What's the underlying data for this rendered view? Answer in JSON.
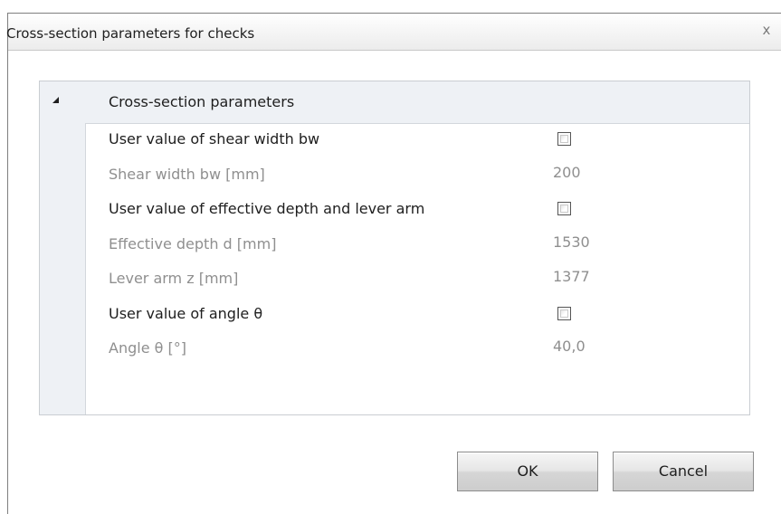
{
  "dialog": {
    "title": "Cross-section parameters for checks",
    "close_icon": "close-icon",
    "close_glyph": "x"
  },
  "grid": {
    "section_title": "Cross-section parameters",
    "section_expanded": true,
    "rows": [
      {
        "label": "User value of shear width bw",
        "type": "checkbox",
        "checked": false,
        "enabled": true
      },
      {
        "label": "Shear width bw [mm]",
        "type": "value",
        "value": "200",
        "enabled": false
      },
      {
        "label": "User value of effective depth and lever arm",
        "type": "checkbox",
        "checked": false,
        "enabled": true
      },
      {
        "label": "Effective depth d [mm]",
        "type": "value",
        "value": "1530",
        "enabled": false
      },
      {
        "label": "Lever arm z [mm]",
        "type": "value",
        "value": "1377",
        "enabled": false
      },
      {
        "label": "User value of angle θ",
        "type": "checkbox",
        "checked": false,
        "enabled": true
      },
      {
        "label": "Angle θ [°]",
        "type": "value",
        "value": "40,0",
        "enabled": false
      }
    ]
  },
  "buttons": {
    "ok_label": "OK",
    "cancel_label": "Cancel"
  },
  "colors": {
    "header_bg": "#eef1f5",
    "disabled_text": "#8f8f8f",
    "enabled_text": "#1e1e1e"
  }
}
